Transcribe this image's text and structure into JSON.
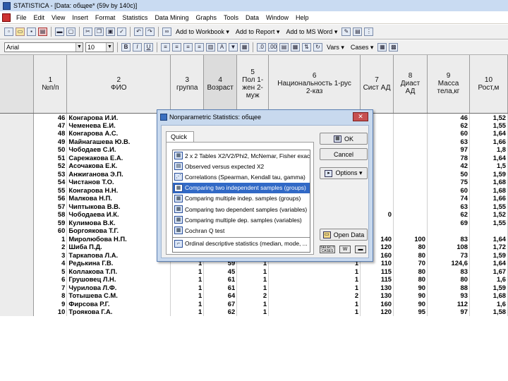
{
  "window": {
    "title": "STATISTICA - [Data: общее* (59v by 140c)]"
  },
  "menu": [
    "File",
    "Edit",
    "View",
    "Insert",
    "Format",
    "Statistics",
    "Data Mining",
    "Graphs",
    "Tools",
    "Data",
    "Window",
    "Help"
  ],
  "toolbar1": {
    "add_workbook": "Add to Workbook ▾",
    "add_report": "Add to Report ▾",
    "add_ms_word": "Add to MS Word ▾"
  },
  "toolbar2": {
    "font": "Arial",
    "size": "10",
    "vars": "Vars ▾",
    "cases": "Cases ▾"
  },
  "sheet": {
    "columns": [
      {
        "num": "1",
        "name": "№п/п"
      },
      {
        "num": "2",
        "name": "ФИО"
      },
      {
        "num": "3",
        "name": "группа"
      },
      {
        "num": "4",
        "name": "Возраст"
      },
      {
        "num": "5",
        "name": "Пол 1-жен 2-муж"
      },
      {
        "num": "6",
        "name": "Национальность 1-рус 2-каз"
      },
      {
        "num": "7",
        "name": "Сист АД"
      },
      {
        "num": "8",
        "name": "Диаст АД"
      },
      {
        "num": "9",
        "name": "Масса тела,кг"
      },
      {
        "num": "10",
        "name": "Рост,м"
      }
    ],
    "rows": [
      {
        "rh": "",
        "c1": "46",
        "c2": "Конгарова И.И.",
        "c3": "",
        "c4": "",
        "c5": "",
        "c6": "",
        "c7": "",
        "c8": "",
        "c9": "46",
        "c10": "1,52"
      },
      {
        "rh": "",
        "c1": "47",
        "c2": "Чеменева Е.И.",
        "c3": "",
        "c4": "",
        "c5": "",
        "c6": "",
        "c7": "",
        "c8": "",
        "c9": "62",
        "c10": "1,55"
      },
      {
        "rh": "",
        "c1": "48",
        "c2": "Конгарова А.С.",
        "c3": "",
        "c4": "",
        "c5": "",
        "c6": "",
        "c7": "",
        "c8": "",
        "c9": "60",
        "c10": "1,64"
      },
      {
        "rh": "",
        "c1": "49",
        "c2": "Майнагашева Ю.В.",
        "c3": "",
        "c4": "",
        "c5": "",
        "c6": "",
        "c7": "",
        "c8": "",
        "c9": "63",
        "c10": "1,66"
      },
      {
        "rh": "",
        "c1": "50",
        "c2": "Чободаев С.И.",
        "c3": "",
        "c4": "",
        "c5": "",
        "c6": "",
        "c7": "",
        "c8": "",
        "c9": "97",
        "c10": "1,8"
      },
      {
        "rh": "",
        "c1": "51",
        "c2": "Сарежакова Е.А.",
        "c3": "",
        "c4": "",
        "c5": "",
        "c6": "",
        "c7": "",
        "c8": "",
        "c9": "78",
        "c10": "1,64"
      },
      {
        "rh": "",
        "c1": "52",
        "c2": "Асочакова Е.К.",
        "c3": "",
        "c4": "",
        "c5": "",
        "c6": "",
        "c7": "",
        "c8": "",
        "c9": "42",
        "c10": "1,5"
      },
      {
        "rh": "",
        "c1": "53",
        "c2": "Анжиганова Э.П.",
        "c3": "",
        "c4": "",
        "c5": "",
        "c6": "",
        "c7": "",
        "c8": "",
        "c9": "50",
        "c10": "1,59"
      },
      {
        "rh": "",
        "c1": "54",
        "c2": "Чистанов Т.О.",
        "c3": "",
        "c4": "",
        "c5": "",
        "c6": "",
        "c7": "",
        "c8": "",
        "c9": "75",
        "c10": "1,68"
      },
      {
        "rh": "",
        "c1": "55",
        "c2": "Конгарова Н.Н.",
        "c3": "",
        "c4": "",
        "c5": "",
        "c6": "",
        "c7": "",
        "c8": "",
        "c9": "60",
        "c10": "1,68"
      },
      {
        "rh": "",
        "c1": "56",
        "c2": "Малкова Н.П.",
        "c3": "",
        "c4": "",
        "c5": "",
        "c6": "",
        "c7": "",
        "c8": "",
        "c9": "74",
        "c10": "1,66"
      },
      {
        "rh": "",
        "c1": "57",
        "c2": "Чиптыкова В.В.",
        "c3": "",
        "c4": "",
        "c5": "",
        "c6": "",
        "c7": "",
        "c8": "",
        "c9": "63",
        "c10": "1,55"
      },
      {
        "rh": "",
        "c1": "58",
        "c2": "Чободаева И.К.",
        "c3": "",
        "c4": "",
        "c5": "",
        "c6": "",
        "c7": "0",
        "c8": "",
        "c9": "62",
        "c10": "1,52"
      },
      {
        "rh": "",
        "c1": "59",
        "c2": "Кулимова В.К.",
        "c3": "",
        "c4": "",
        "c5": "",
        "c6": "",
        "c7": "",
        "c8": "",
        "c9": "69",
        "c10": "1,55"
      },
      {
        "rh": "",
        "c1": "60",
        "c2": "Боргоякова Т.Г.",
        "c3": "",
        "c4": "",
        "c5": "",
        "c6": "",
        "c7": "",
        "c8": "",
        "c9": "",
        "c10": ""
      },
      {
        "rh": "",
        "c1": "1",
        "c2": "Миролюбова Н.П.",
        "c3": "",
        "c4": "",
        "c5": "",
        "c6": "",
        "c7": "140",
        "c8": "100",
        "c9": "83",
        "c10": "1,64"
      },
      {
        "rh": "",
        "c1": "2",
        "c2": "Шиба П.Д.",
        "c3": "",
        "c4": "",
        "c5": "",
        "c6": "",
        "c7": "120",
        "c8": "80",
        "c9": "108",
        "c10": "1,72"
      },
      {
        "rh": "",
        "c1": "3",
        "c2": "Таркапова Л.А.",
        "c3": "1",
        "c4": "64",
        "c5": "1",
        "c6": "2",
        "c7": "160",
        "c8": "80",
        "c9": "73",
        "c10": "1,59"
      },
      {
        "rh": "",
        "c1": "4",
        "c2": "Редькина Г.В.",
        "c3": "1",
        "c4": "59",
        "c5": "1",
        "c6": "1",
        "c7": "110",
        "c8": "70",
        "c9": "124,6",
        "c10": "1,64"
      },
      {
        "rh": "",
        "c1": "5",
        "c2": "Коллакова Т.П.",
        "c3": "1",
        "c4": "45",
        "c5": "1",
        "c6": "1",
        "c7": "115",
        "c8": "80",
        "c9": "83",
        "c10": "1,67"
      },
      {
        "rh": "",
        "c1": "6",
        "c2": "Грушовец Л.Н.",
        "c3": "1",
        "c4": "61",
        "c5": "1",
        "c6": "1",
        "c7": "115",
        "c8": "80",
        "c9": "80",
        "c10": "1,6"
      },
      {
        "rh": "",
        "c1": "7",
        "c2": "Чурилова Л.Ф.",
        "c3": "1",
        "c4": "61",
        "c5": "1",
        "c6": "1",
        "c7": "130",
        "c8": "90",
        "c9": "88",
        "c10": "1,59"
      },
      {
        "rh": "",
        "c1": "8",
        "c2": "Тотышева С.М.",
        "c3": "1",
        "c4": "64",
        "c5": "2",
        "c6": "2",
        "c7": "130",
        "c8": "90",
        "c9": "93",
        "c10": "1,68"
      },
      {
        "rh": "",
        "c1": "9",
        "c2": "Фирсова Р.Г.",
        "c3": "1",
        "c4": "67",
        "c5": "1",
        "c6": "1",
        "c7": "160",
        "c8": "90",
        "c9": "112",
        "c10": "1,6"
      },
      {
        "rh": "",
        "c1": "10",
        "c2": "Троякова Г.А.",
        "c3": "1",
        "c4": "62",
        "c5": "1",
        "c6": "1",
        "c7": "120",
        "c8": "95",
        "c9": "97",
        "c10": "1,58"
      }
    ]
  },
  "dialog": {
    "title": "Nonparametric Statistics: общее",
    "close": "✕",
    "tab": "Quick",
    "items": [
      {
        "icon": "▦",
        "label": "2 x 2 Tables X2/V2/Phi2, McNemar, Fisher exact",
        "selected": false
      },
      {
        "icon": "▤",
        "label": "Observed versus expected X2",
        "selected": false
      },
      {
        "icon": "⋰",
        "label": "Correlations (Spearman, Kendall tau, gamma)",
        "selected": false
      },
      {
        "icon": "▦",
        "label": "Comparing two independent samples (groups)",
        "selected": true
      },
      {
        "icon": "▦",
        "label": "Comparing multiple indep. samples (groups)",
        "selected": false
      },
      {
        "icon": "▦",
        "label": "Comparing two dependent samples (variables)",
        "selected": false
      },
      {
        "icon": "▦",
        "label": "Comparing multiple dep. samples (variables)",
        "selected": false
      },
      {
        "icon": "▦",
        "label": "Cochran Q test",
        "selected": false
      }
    ],
    "last_item": {
      "icon": "⌐",
      "label": "Ordinal descriptive statistics (median, mode, ..."
    },
    "buttons": {
      "ok": "OK",
      "cancel": "Cancel",
      "options": "Options ▾",
      "open_data": "Open Data"
    },
    "bottom": {
      "select_cases": "SELECT CASES",
      "w": "W"
    }
  }
}
